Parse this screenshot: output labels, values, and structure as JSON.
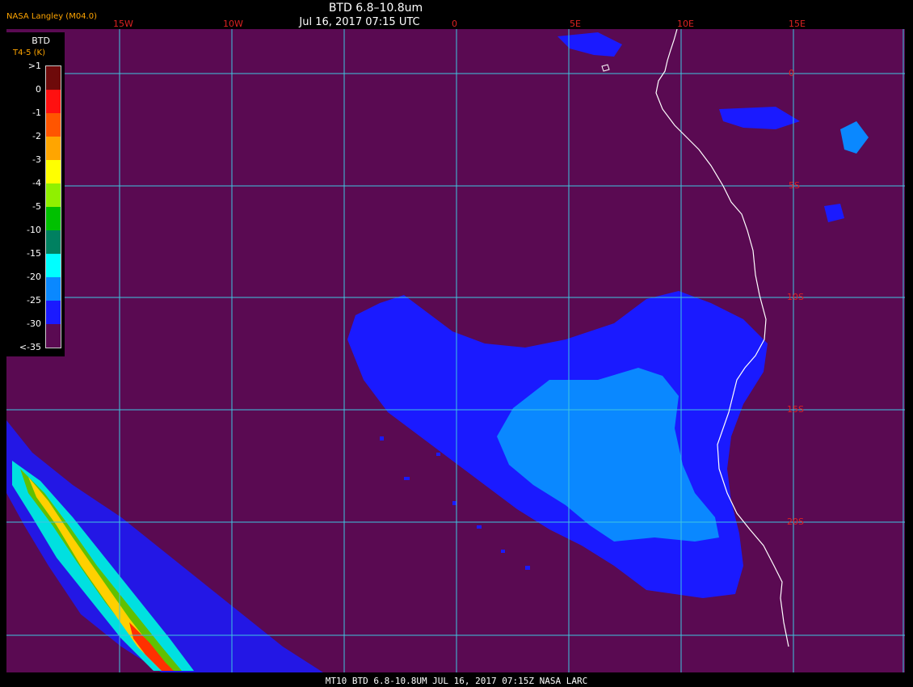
{
  "header": {
    "title": "BTD 6.8–10.8um",
    "datetime": "Jul 16, 2017 07:15 UTC",
    "producer": "NASA Langley (M04.0)"
  },
  "footer": {
    "caption": "MT10  BTD 6.8-10.8UM  JUL 16, 2017 07:15Z  NASA LARC"
  },
  "map": {
    "lon_labels": [
      "15W",
      "10W",
      "0",
      "5E",
      "10E",
      "15E"
    ],
    "lat_labels": [
      "0",
      "5S",
      "10S",
      "15S",
      "20S"
    ],
    "colors": {
      "background": "#5a0a52",
      "grid": "#3fc6e0",
      "coast": "#ffffff",
      "light_blue": "#0a88ff",
      "blue": "#1a1aff"
    }
  },
  "legend": {
    "title": "BTD",
    "unit": "T4-5 (K)",
    "ticks": [
      ">1",
      "0",
      "-1",
      "-2",
      "-3",
      "-4",
      "-5",
      "-10",
      "-15",
      "-20",
      "-25",
      "-30",
      "<-35"
    ],
    "colors": [
      "#6e0a0a",
      "#ff1010",
      "#ff5500",
      "#ffa500",
      "#ffff00",
      "#90f000",
      "#00c000",
      "#008060",
      "#00ffff",
      "#0a88ff",
      "#1a1aff",
      "#5a0a52"
    ]
  }
}
